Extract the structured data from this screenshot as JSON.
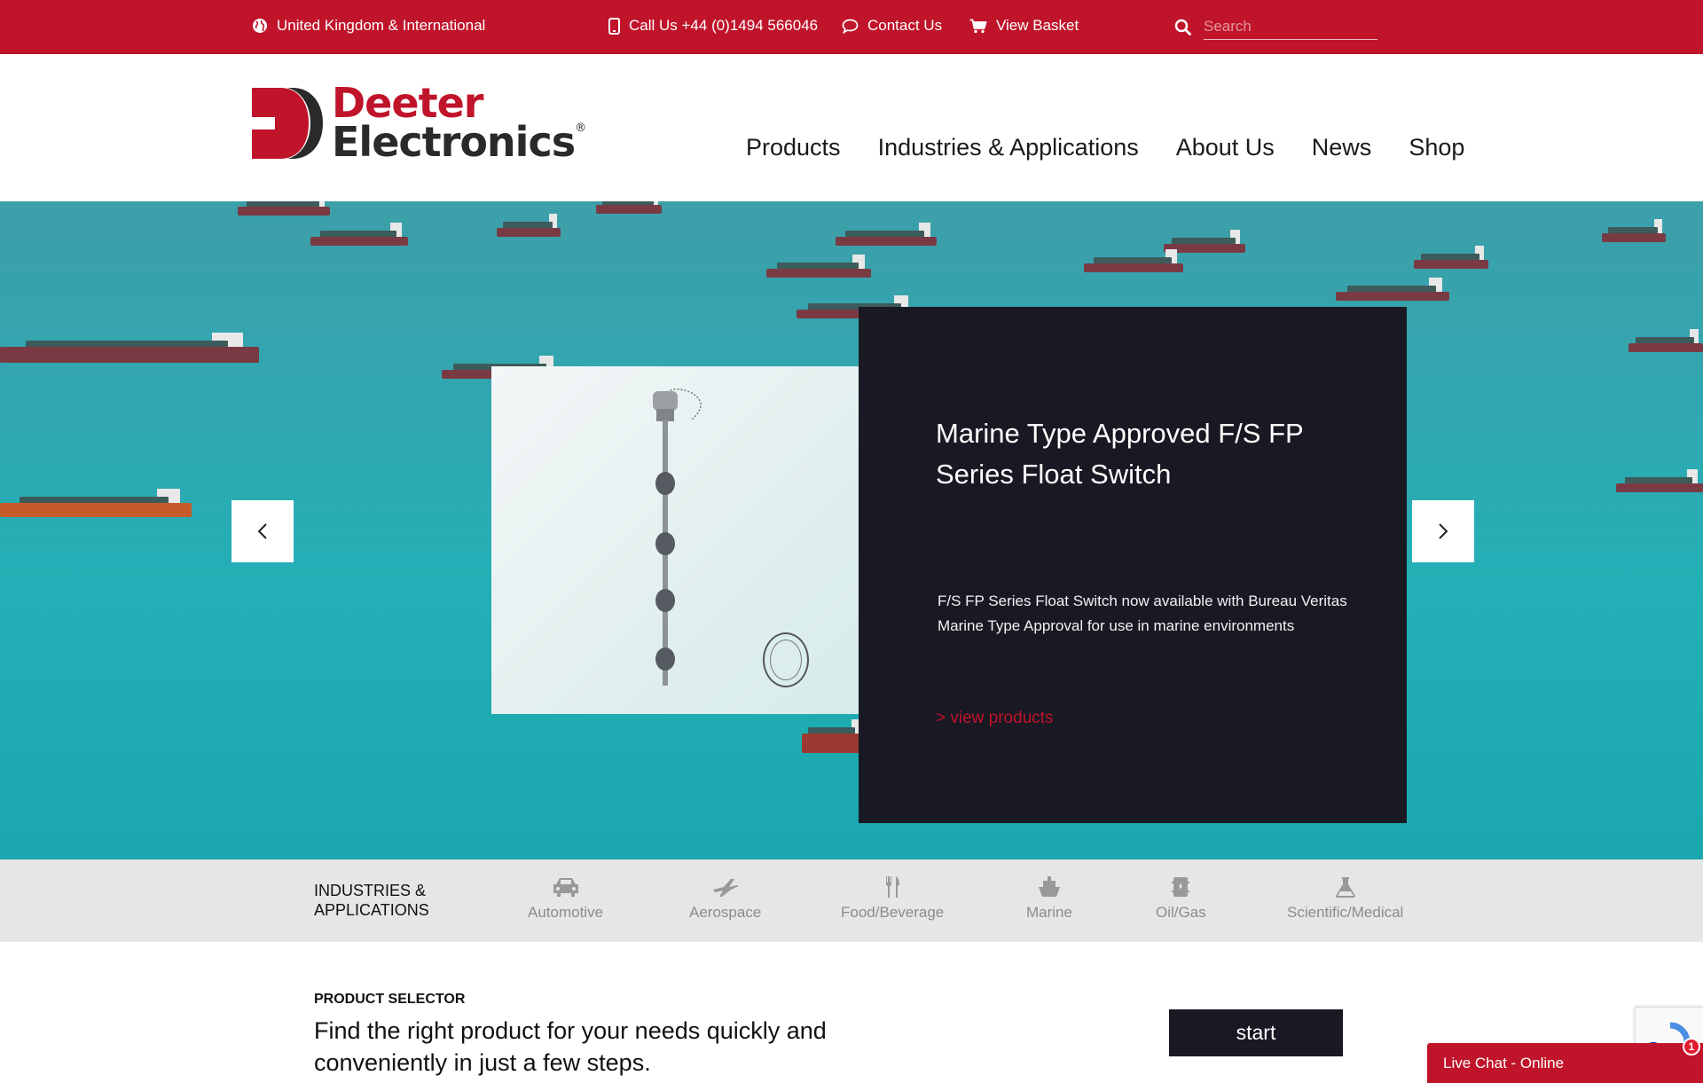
{
  "topbar": {
    "region": "United Kingdom & International",
    "phone": "Call Us +44 (0)1494 566046",
    "contact": "Contact Us",
    "basket": "View Basket",
    "search_placeholder": "Search"
  },
  "logo": {
    "line1": "Deeter",
    "line2": "Electronics",
    "reg": "®"
  },
  "nav": [
    "Products",
    "Industries & Applications",
    "About Us",
    "News",
    "Shop"
  ],
  "hero": {
    "title": "Marine Type Approved F/S FP Series Float Switch",
    "description": "F/S FP Series Float Switch now available with Bureau Veritas Marine Type Approval for use in marine environments",
    "link": "> view products"
  },
  "industries": {
    "title_line1": "INDUSTRIES &",
    "title_line2": "APPLICATIONS",
    "items": [
      {
        "label": "Automotive",
        "icon": "car-icon"
      },
      {
        "label": "Aerospace",
        "icon": "plane-icon"
      },
      {
        "label": "Food/Beverage",
        "icon": "fork-knife-icon"
      },
      {
        "label": "Marine",
        "icon": "ship-icon"
      },
      {
        "label": "Oil/Gas",
        "icon": "oil-barrel-icon"
      },
      {
        "label": "Scientific/Medical",
        "icon": "flask-icon"
      }
    ]
  },
  "product_selector": {
    "label": "PRODUCT SELECTOR",
    "text": "Find the right product for your needs quickly and conveniently in just a few steps.",
    "button": "start"
  },
  "livechat": {
    "label": "Live Chat - Online",
    "badge": "1"
  },
  "colors": {
    "brand_red": "#c0142a",
    "dark": "#181923",
    "industries_bg": "#e6e6e6"
  }
}
